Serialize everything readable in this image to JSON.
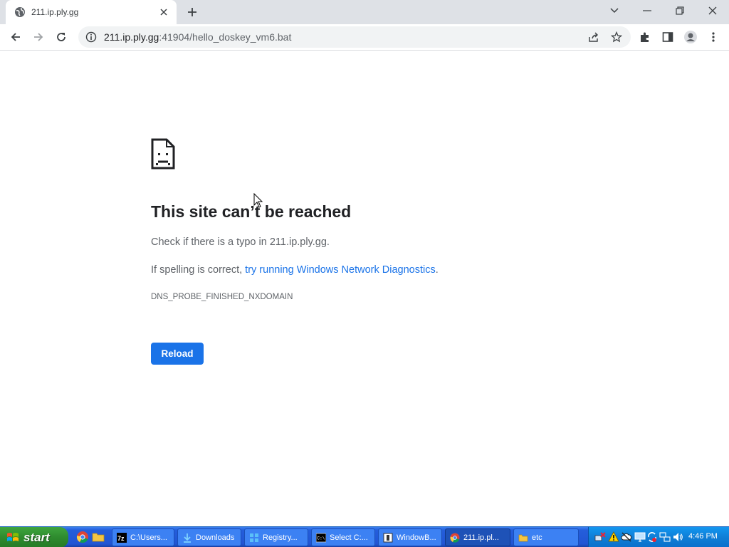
{
  "browser": {
    "tab": {
      "title": "211.ip.ply.gg"
    },
    "window_controls": [
      "tab-search",
      "minimize",
      "restore",
      "close"
    ],
    "address_bar": {
      "host": "211.ip.ply.gg",
      "rest": ":41904/hello_doskey_vm6.bat"
    }
  },
  "error_page": {
    "title": "This site can’t be reached",
    "line1": "Check if there is a typo in 211.ip.ply.gg.",
    "line2_prefix": "If spelling is correct, ",
    "line2_link": "try running Windows Network Diagnostics",
    "line2_suffix": ".",
    "error_code": "DNS_PROBE_FINISHED_NXDOMAIN",
    "reload_label": "Reload"
  },
  "taskbar": {
    "start_label": "start",
    "tasks": [
      {
        "label": "C:\\Users...",
        "icon": "7zip-icon"
      },
      {
        "label": "Downloads",
        "icon": "download-icon"
      },
      {
        "label": "Registry...",
        "icon": "registry-icon"
      },
      {
        "label": "Select C:...",
        "icon": "cmd-icon"
      },
      {
        "label": "WindowB...",
        "icon": "window-icon"
      },
      {
        "label": "211.ip.pl...",
        "icon": "chrome-icon",
        "active": true
      },
      {
        "label": "etc",
        "icon": "folder-icon"
      }
    ],
    "clock": "4:46 PM"
  },
  "colors": {
    "link": "#1a73e8",
    "reload_button": "#1a73e8",
    "taskbar": "#245edb",
    "start_button": "#2e8b2e",
    "tray": "#0f7ed6"
  }
}
